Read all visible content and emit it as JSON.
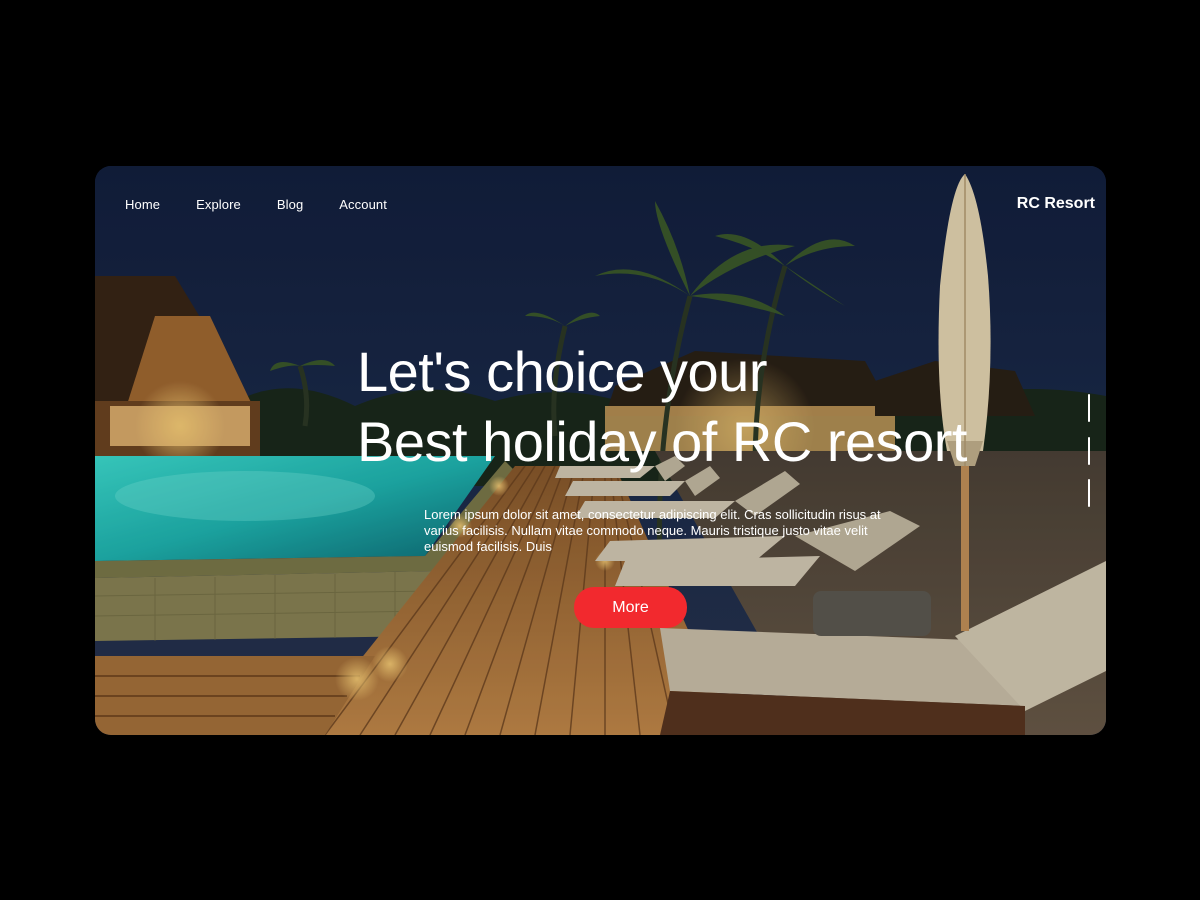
{
  "nav": {
    "items": [
      {
        "label": "Home"
      },
      {
        "label": "Explore"
      },
      {
        "label": "Blog"
      },
      {
        "label": "Account"
      }
    ]
  },
  "brand": "RC Resort",
  "hero": {
    "line1": "Let's choice your",
    "line2": "Best holiday of RC resort",
    "description": "Lorem ipsum dolor sit amet, consectetur adipiscing elit. Cras sollicitudin risus at varius facilisis. Nullam vitae commodo neque. Mauris tristique justo vitae velit euismod facilisis. Duis",
    "button_label": "More"
  },
  "slider": {
    "count": 3,
    "active_index": 1
  },
  "colors": {
    "accent": "#f2292e",
    "page_background": "#000000",
    "text": "#ffffff"
  }
}
